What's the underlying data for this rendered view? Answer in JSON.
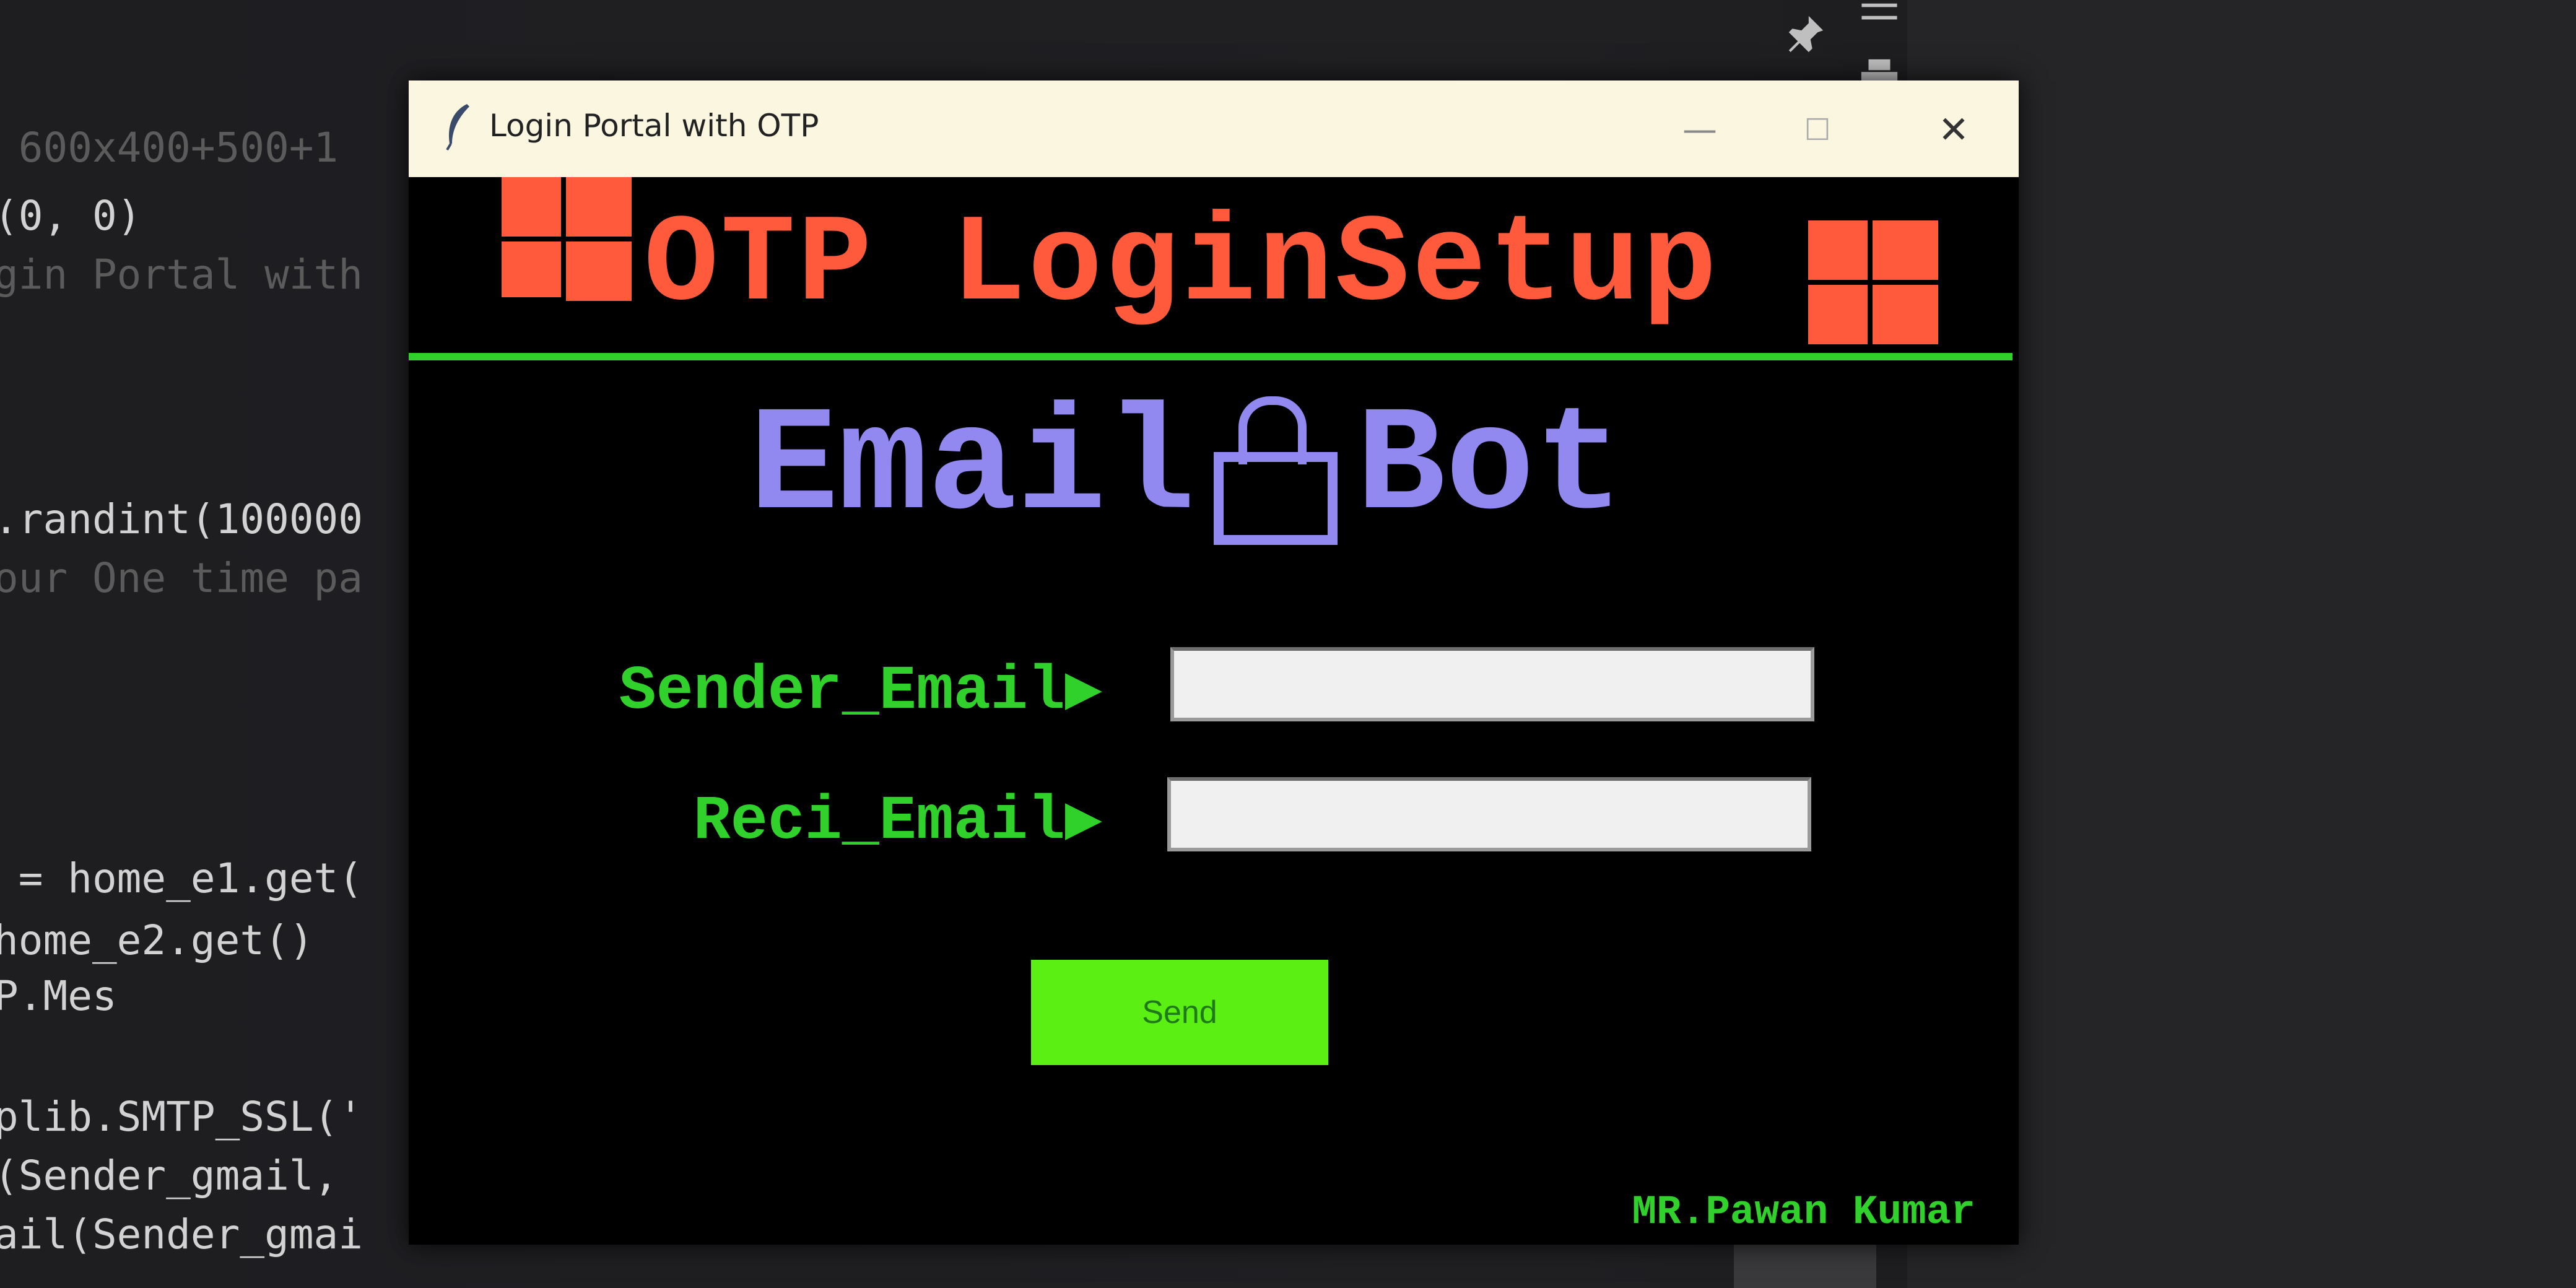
{
  "editor": {
    "lines": [
      {
        "text": " 600x400+500+1",
        "dim": true
      },
      {
        "text": "(0, 0)",
        "dim": false
      },
      {
        "text": "gin Portal with",
        "dim": true
      },
      {
        "text": ".randint(100000",
        "dim": false
      },
      {
        "text": "our One time pa",
        "dim": true
      },
      {
        "text": " = home_e1.get(",
        "dim": false
      },
      {
        "text": "home_e2.get()",
        "dim": false
      },
      {
        "text": "P.Mes",
        "dim": false
      },
      {
        "text": "plib.SMTP_SSL('",
        "dim": false
      },
      {
        "text": "(Sender_gmail,",
        "dim": false
      },
      {
        "text": "ail(Sender_gmai",
        "dim": false
      }
    ],
    "toolbar_icons": [
      "pin-icon",
      "printer-icon",
      "sort-icon"
    ]
  },
  "window": {
    "title": "Login Portal with OTP",
    "controls": {
      "minimize": "—",
      "maximize": "☐",
      "close": "✕"
    },
    "heading": "OTP LoginSetup",
    "subtitle": {
      "left": "Email",
      "right": "Bot",
      "icon": "lock-icon"
    },
    "fields": [
      {
        "label": "Sender_Email▶",
        "value": "",
        "placeholder": ""
      },
      {
        "label": "Reci_Email▶",
        "value": "",
        "placeholder": ""
      }
    ],
    "send_label": "Send",
    "credit": "MR.Pawan Kumar",
    "colors": {
      "heading": "#ff5a3c",
      "subtitle": "#9188f0",
      "label": "#2fd12a",
      "button": "#5cef14",
      "background": "#000000"
    }
  }
}
